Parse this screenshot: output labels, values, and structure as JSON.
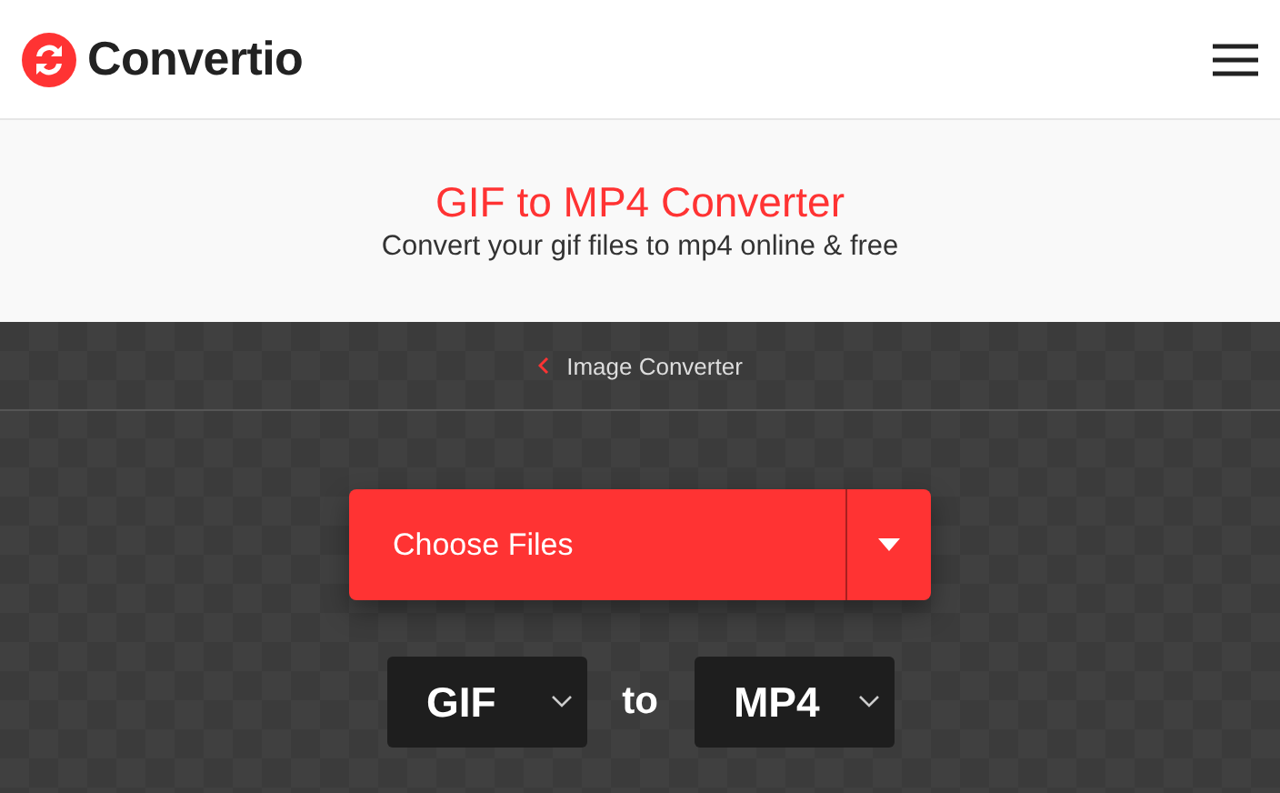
{
  "header": {
    "brand": "Convertio"
  },
  "hero": {
    "title": "GIF to MP4 Converter",
    "subtitle": "Convert your gif files to mp4 online & free"
  },
  "breadcrumb": {
    "label": "Image Converter"
  },
  "upload": {
    "label": "Choose Files"
  },
  "conversion": {
    "from": "GIF",
    "joiner": "to",
    "target": "MP4"
  }
}
